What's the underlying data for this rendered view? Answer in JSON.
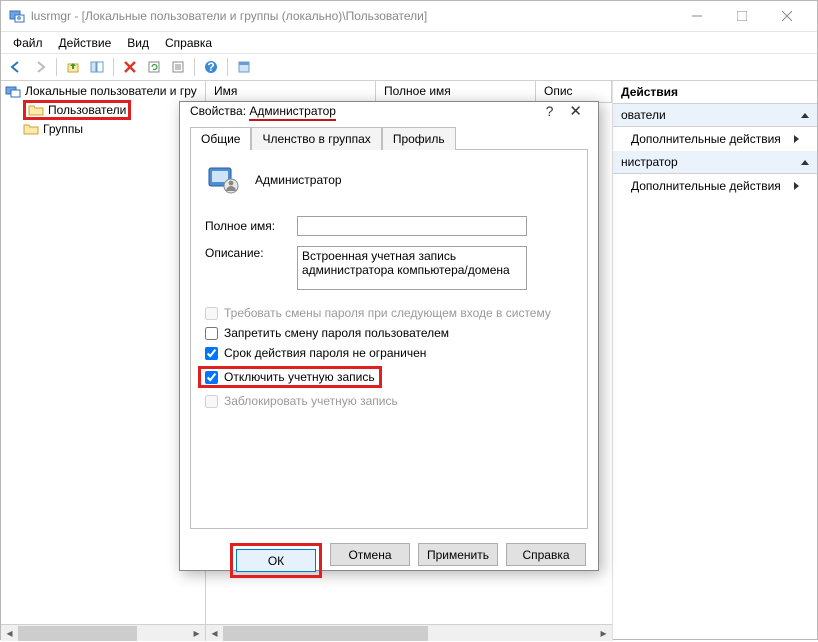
{
  "title": "lusrmgr - [Локальные пользователи и группы (локально)\\Пользователи]",
  "menu": {
    "file": "Файл",
    "action": "Действие",
    "view": "Вид",
    "help": "Справка"
  },
  "tree": {
    "root": "Локальные пользователи и гру",
    "users": "Пользователи",
    "groups": "Группы"
  },
  "columns": {
    "name": "Имя",
    "fullname": "Полное имя",
    "desc": "Опис"
  },
  "actions": {
    "title": "Действия",
    "section_users": "ователи",
    "more1": "Дополнительные действия",
    "section_admin": "нистратор",
    "more2": "Дополнительные действия"
  },
  "dialog": {
    "title_prefix": "Свойства: ",
    "title_name": "Администратор",
    "tabs": {
      "general": "Общие",
      "member": "Членство в группах",
      "profile": "Профиль"
    },
    "username": "Администратор",
    "fullname_label": "Полное имя:",
    "fullname_value": "",
    "desc_label": "Описание:",
    "desc_value": "Встроенная учетная запись администратора компьютера/домена",
    "check_change_next": "Требовать смены пароля при следующем входе в систему",
    "check_no_change": "Запретить смену пароля пользователем",
    "check_no_expire": "Срок действия пароля не ограничен",
    "check_disable": "Отключить учетную запись",
    "check_locked": "Заблокировать учетную запись",
    "btn_ok": "ОК",
    "btn_cancel": "Отмена",
    "btn_apply": "Применить",
    "btn_help": "Справка"
  }
}
